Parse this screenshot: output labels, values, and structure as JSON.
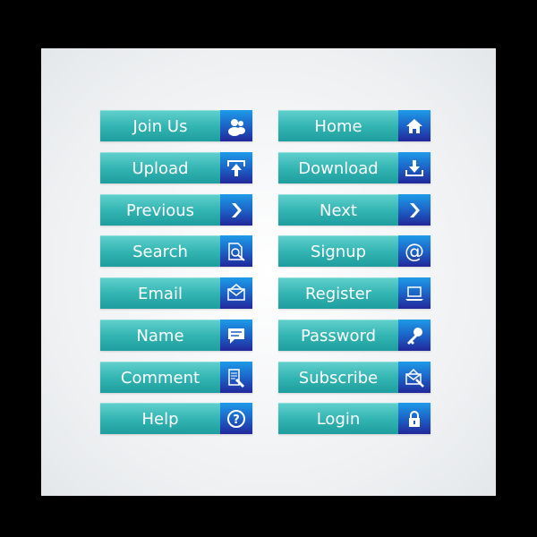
{
  "colors": {
    "background": "#000000",
    "panel": "#f0f2f4",
    "button": "#33b5b3",
    "icon_box": "#1c5ec4"
  },
  "buttons": [
    {
      "label": "Join Us",
      "icon": "users-icon"
    },
    {
      "label": "Home",
      "icon": "home-icon"
    },
    {
      "label": "Upload",
      "icon": "upload-icon"
    },
    {
      "label": "Download",
      "icon": "download-icon"
    },
    {
      "label": "Previous",
      "icon": "chevron-right-icon"
    },
    {
      "label": "Next",
      "icon": "chevron-right-icon"
    },
    {
      "label": "Search",
      "icon": "search-document-icon"
    },
    {
      "label": "Signup",
      "icon": "at-icon"
    },
    {
      "label": "Email",
      "icon": "envelope-icon"
    },
    {
      "label": "Register",
      "icon": "laptop-icon"
    },
    {
      "label": "Name",
      "icon": "speech-bubble-icon"
    },
    {
      "label": "Password",
      "icon": "key-icon"
    },
    {
      "label": "Comment",
      "icon": "document-pen-icon"
    },
    {
      "label": "Subscribe",
      "icon": "envelope-cursor-icon"
    },
    {
      "label": "Help",
      "icon": "question-icon"
    },
    {
      "label": "Login",
      "icon": "lock-icon"
    }
  ]
}
